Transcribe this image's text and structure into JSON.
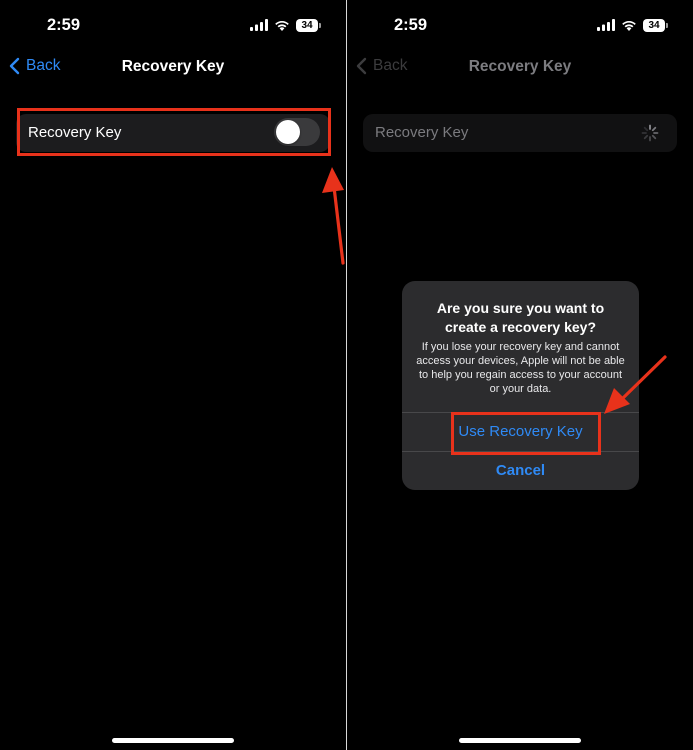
{
  "status_bar": {
    "time": "2:59",
    "battery": "34"
  },
  "left_screen": {
    "nav": {
      "back_label": "Back",
      "title": "Recovery Key"
    },
    "row": {
      "label": "Recovery Key",
      "toggle_on": false
    }
  },
  "right_screen": {
    "nav": {
      "back_label": "Back",
      "title": "Recovery Key"
    },
    "row": {
      "label": "Recovery Key"
    },
    "alert": {
      "title": "Are you sure you want to create a recovery key?",
      "message": "If you lose your recovery key and cannot access your devices, Apple will not be able to help you regain access to your account or your data.",
      "primary_button": "Use Recovery Key",
      "cancel_button": "Cancel"
    }
  },
  "colors": {
    "accent": "#2f8af5",
    "highlight": "#e8321b",
    "background": "#000000",
    "cell": "#1c1c1e",
    "alert_bg": "#2c2c2e"
  },
  "icons": [
    "cellular-signal-icon",
    "wifi-icon",
    "battery-icon",
    "chevron-left-icon",
    "loading-spinner-icon",
    "red-arrow-annotation"
  ]
}
